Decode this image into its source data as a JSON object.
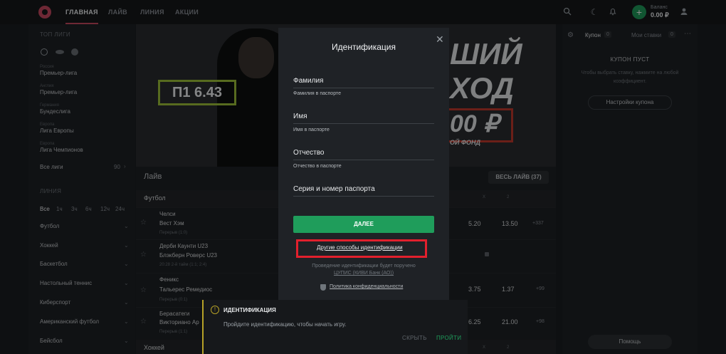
{
  "topbar": {
    "nav": [
      "ГЛАВНАЯ",
      "ЛАЙВ",
      "ЛИНИЯ",
      "АКЦИИ"
    ],
    "balance_label": "Баланс",
    "balance_value": "0.00 ₽",
    "icons": [
      "search-icon",
      "moon-icon",
      "bell-icon",
      "plus-icon",
      "user-icon"
    ]
  },
  "sidebar": {
    "top_leagues_title": "ТОП ЛИГИ",
    "leagues": [
      {
        "country": "Россия",
        "name": "Премьер-лига"
      },
      {
        "country": "Англия",
        "name": "Премьер-лига"
      },
      {
        "country": "Германия",
        "name": "Бундеслига"
      },
      {
        "country": "Европа",
        "name": "Лига Европы"
      },
      {
        "country": "Европа",
        "name": "Лига Чемпионов"
      }
    ],
    "all_leagues": "Все лиги",
    "all_leagues_count": "90",
    "line_title": "ЛИНИЯ",
    "filters": [
      "Все",
      "1ч",
      "3ч",
      "6ч",
      "12ч",
      "24ч"
    ],
    "sports": [
      "Футбол",
      "Хоккей",
      "Баскетбол",
      "Настольный теннис",
      "Киберспорт",
      "Американский футбол",
      "Бейсбол"
    ]
  },
  "banner": {
    "odds": "П1 6.43",
    "line1": "ШИЙ",
    "line2": "ХОД",
    "line3": "00 ₽",
    "line4": "ОЙ ФОНД"
  },
  "main": {
    "live_title": "Лайв",
    "all_live": "ВЕСЬ ЛАЙВ (37)",
    "sport_football": "Футбол",
    "col_x": "X",
    "col_2": "2",
    "matches": [
      {
        "team1": "Челси",
        "team2": "Вест Хэм",
        "meta": "Перерыв (1:0)",
        "x": "5.20",
        "two": "13.50",
        "more": "+337"
      },
      {
        "team1": "Дерби Каунти U23",
        "team2": "Блэкберн Роверс U23",
        "meta": "20:28 2-й тайм (1:1; 2:4)",
        "x": "",
        "two": "",
        "more": ""
      },
      {
        "team1": "Феникс",
        "team2": "Тальерес Ремедиос",
        "meta": "Перерыв (0:1)",
        "x": "3.75",
        "two": "1.37",
        "more": "+99"
      },
      {
        "team1": "Берасатеги",
        "team2": "Викториано Ар",
        "meta": "Перерыв (1:1)",
        "x": "6.25",
        "two": "21.00",
        "more": "+98"
      }
    ],
    "sport_hockey": "Хоккей"
  },
  "coupon": {
    "tab_coupon": "Купон",
    "tab_coupon_count": "0",
    "tab_bets": "Мои ставки",
    "tab_bets_count": "0",
    "empty_title": "КУПОН ПУСТ",
    "empty_text": "Чтобы выбрать ставку, нажмите на любой коэффициент.",
    "settings_button": "Настройки купона",
    "help_button": "Помощь"
  },
  "modal": {
    "title": "Идентификация",
    "fields": [
      {
        "label": "Фамилия",
        "hint": "Фамилия в паспорте"
      },
      {
        "label": "Имя",
        "hint": "Имя в паспорте"
      },
      {
        "label": "Отчество",
        "hint": "Отчество в паспорте"
      },
      {
        "label": "Серия и номер паспорта",
        "hint": ""
      }
    ],
    "next_button": "ДАЛЕЕ",
    "other_methods": "Другие способы идентификации",
    "note_line1": "Проведение идентификации будет поручено",
    "note_line2": "ЦУПИС (КИВИ Банк (АО))",
    "privacy": "Политика конфиденциальности"
  },
  "notification": {
    "title": "ИДЕНТИФИКАЦИЯ",
    "body": "Пройдите идентификацию, чтобы начать игру.",
    "hide": "СКРЫТЬ",
    "go": "ПРОЙТИ"
  },
  "colors": {
    "accent": "#1f9d5b",
    "brand": "#c94a62",
    "highlight": "#e2202d",
    "warning": "#b6a127"
  }
}
